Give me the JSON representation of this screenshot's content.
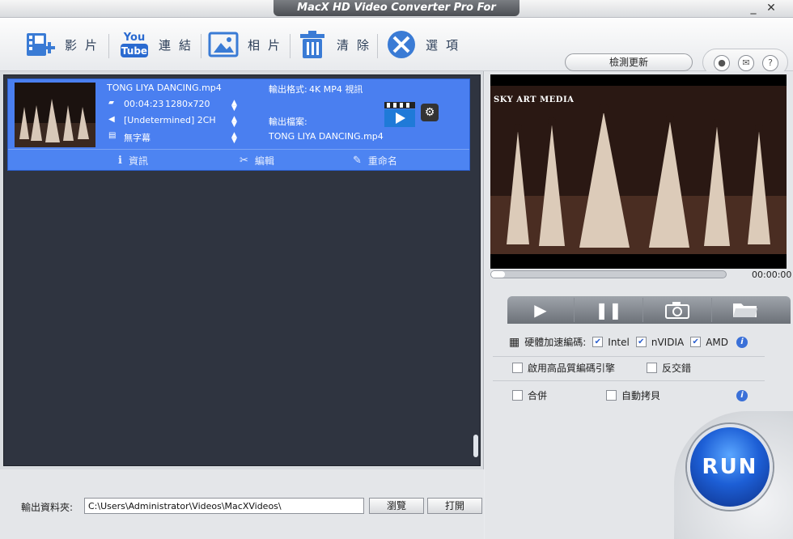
{
  "window": {
    "title": "MacX HD Video Converter Pro For Windows"
  },
  "toolbar": {
    "video_label": "影片",
    "youtube_label": "連結",
    "photo_label": "相片",
    "clear_label": "清除",
    "options_label": "選項",
    "update_label": "檢測更新"
  },
  "item": {
    "filename": "TONG LIYA DANCING.mp4",
    "duration": "00:04:23",
    "resolution": "1280x720",
    "audio": "[Undetermined] 2CH",
    "subtitle": "無字幕",
    "output_format_label": "輸出格式:",
    "output_format_value": "4K MP4 視訊",
    "output_file_label": "輸出檔案:",
    "output_file_value": "TONG LIYA DANCING.mp4",
    "info_label": "資訊",
    "edit_label": "編輯",
    "rename_label": "重命名"
  },
  "bottom": {
    "output_folder_label": "輸出資料夾:",
    "output_folder_value": "C:\\Users\\Administrator\\Videos\\MacXVideos\\",
    "browse_label": "瀏覽",
    "open_label": "打開"
  },
  "preview": {
    "watermark": "SKY ART MEDIA",
    "timecode": "00:00:00",
    "progress": 0.06
  },
  "settings": {
    "hw_accel_label": "硬體加速編碼:",
    "intel_label": "Intel",
    "intel_checked": true,
    "nvidia_label": "nVIDIA",
    "nvidia_checked": true,
    "amd_label": "AMD",
    "amd_checked": true,
    "hq_engine_label": "啟用高品質編碼引擎",
    "hq_engine_checked": false,
    "deinterlace_label": "反交錯",
    "deinterlace_checked": false,
    "merge_label": "合併",
    "merge_checked": false,
    "autocopy_label": "自動拷貝",
    "autocopy_checked": false
  },
  "run_label": "RUN",
  "colors": {
    "accent": "#4a7ff0",
    "run_blue": "#1d5fd6",
    "list_bg": "#2f3440"
  }
}
